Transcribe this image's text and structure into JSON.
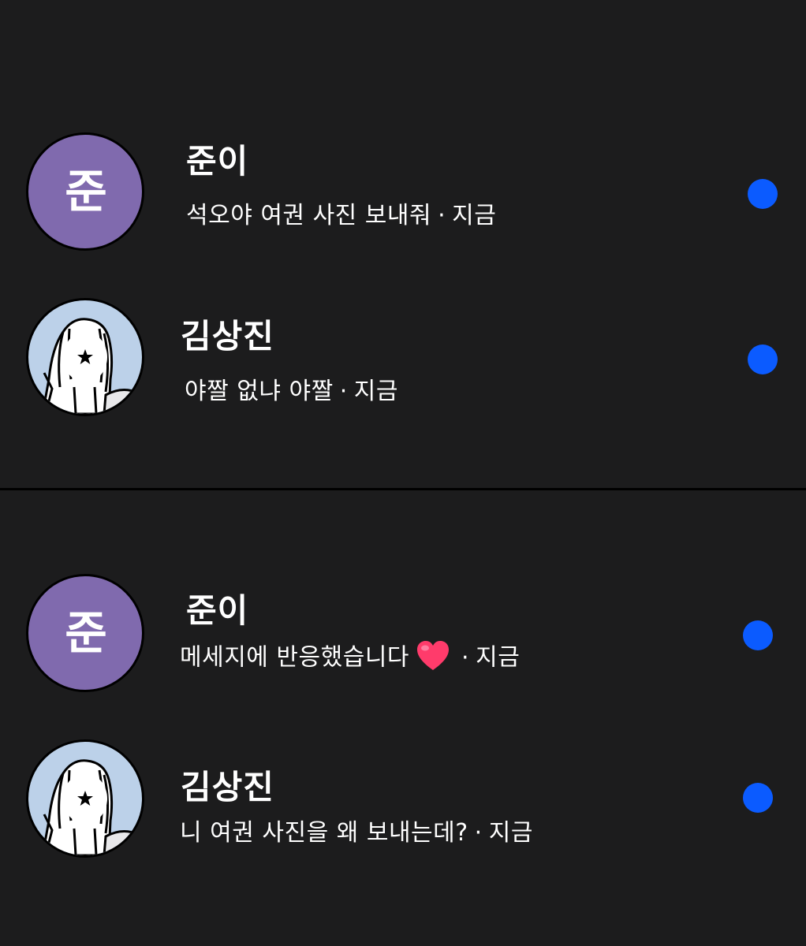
{
  "panels": [
    {
      "threads": [
        {
          "name": "준이",
          "avatar_text": "준",
          "avatar_color": "#806aae",
          "message": "석오야 여권 사진 보내줘",
          "separator": "·",
          "time": "지금",
          "unread": true
        },
        {
          "name": "김상진",
          "avatar_icon": "drawn-character-avatar",
          "message": "야짤 없냐 야짤",
          "separator": "·",
          "time": "지금",
          "unread": true
        }
      ]
    },
    {
      "threads": [
        {
          "name": "준이",
          "avatar_text": "준",
          "avatar_color": "#806aae",
          "message": "메세지에 반응했습니다",
          "reaction_icon": "red-heart-icon",
          "separator": "·",
          "time": "지금",
          "unread": true
        },
        {
          "name": "김상진",
          "avatar_icon": "drawn-character-avatar",
          "message": "니 여권 사진을 왜 보내는데?",
          "separator": "·",
          "time": "지금",
          "unread": true
        }
      ]
    }
  ],
  "colors": {
    "background": "#1c1c1d",
    "unread_dot": "#0b5bff",
    "avatar_purple": "#806aae",
    "avatar_blue": "#bcd1e9",
    "heart": "#ff3b6b"
  }
}
